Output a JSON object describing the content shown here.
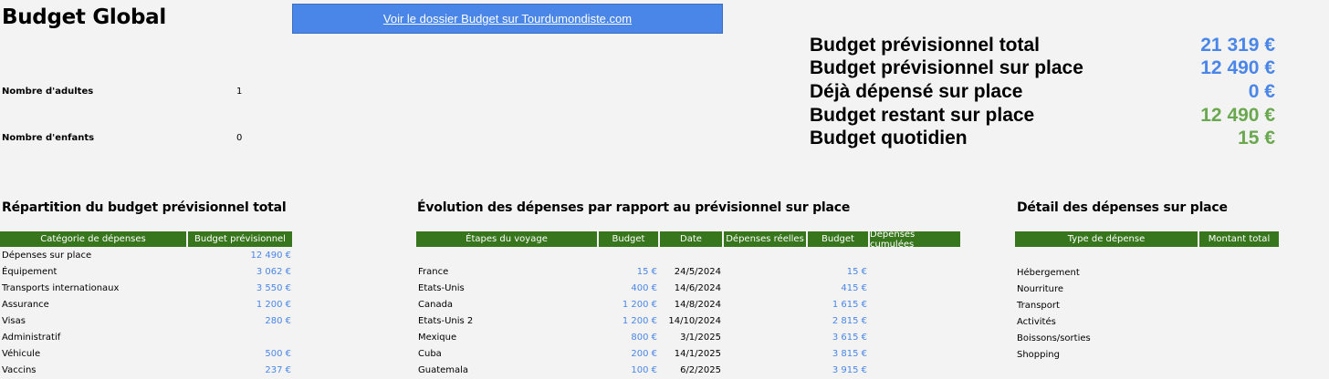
{
  "title": "Budget Global",
  "link": {
    "label": "Voir le dossier Budget sur Tourdumondiste.com"
  },
  "params": [
    {
      "label": "Nombre d'adultes",
      "value": "1"
    },
    {
      "label": "Nombre d'enfants",
      "value": "0"
    }
  ],
  "summary": [
    {
      "label": "Budget prévisionnel total",
      "value": "21 319 €",
      "color": "#4a86e8"
    },
    {
      "label": "Budget prévisionnel sur place",
      "value": "12 490 €",
      "color": "#4a86e8"
    },
    {
      "label": "Déjà dépensé sur place",
      "value": "0 €",
      "color": "#4a86e8"
    },
    {
      "label": "Budget restant sur place",
      "value": "12 490 €",
      "color": "#6aa84f"
    },
    {
      "label": "Budget quotidien",
      "value": "15 €",
      "color": "#6aa84f"
    }
  ],
  "repartition": {
    "title": "Répartition du budget prévisionnel total",
    "headers": [
      "Catégorie de dépenses",
      "Budget prévisionnel"
    ],
    "rows": [
      {
        "cat": "Dépenses sur place",
        "val": "12 490 €"
      },
      {
        "cat": "Équipement",
        "val": "3 062 €"
      },
      {
        "cat": "Transports internationaux",
        "val": "3 550 €"
      },
      {
        "cat": "Assurance",
        "val": "1 200 €"
      },
      {
        "cat": "Visas",
        "val": "280 €"
      },
      {
        "cat": "Administratif",
        "val": ""
      },
      {
        "cat": "Véhicule",
        "val": "500 €"
      },
      {
        "cat": "Vaccins",
        "val": "237 €"
      }
    ]
  },
  "evolution": {
    "title": "Évolution des dépenses par rapport au prévisionnel sur place",
    "headers": [
      "Étapes du voyage",
      "Budget",
      "Date",
      "Dépenses réelles",
      "Budget",
      "Dépenses cumulées"
    ],
    "rows": [
      {
        "etape": "France",
        "budget": "15 €",
        "date": "24/5/2024",
        "reel": "",
        "budget2": "15 €",
        "cumul": ""
      },
      {
        "etape": "Etats-Unis",
        "budget": "400 €",
        "date": "14/6/2024",
        "reel": "",
        "budget2": "415 €",
        "cumul": ""
      },
      {
        "etape": "Canada",
        "budget": "1 200 €",
        "date": "14/8/2024",
        "reel": "",
        "budget2": "1 615 €",
        "cumul": ""
      },
      {
        "etape": "Etats-Unis 2",
        "budget": "1 200 €",
        "date": "14/10/2024",
        "reel": "",
        "budget2": "2 815 €",
        "cumul": ""
      },
      {
        "etape": "Mexique",
        "budget": "800 €",
        "date": "3/1/2025",
        "reel": "",
        "budget2": "3 615 €",
        "cumul": ""
      },
      {
        "etape": "Cuba",
        "budget": "200 €",
        "date": "14/1/2025",
        "reel": "",
        "budget2": "3 815 €",
        "cumul": ""
      },
      {
        "etape": "Guatemala",
        "budget": "100 €",
        "date": "6/2/2025",
        "reel": "",
        "budget2": "3 915 €",
        "cumul": ""
      }
    ]
  },
  "detail": {
    "title": "Détail des dépenses sur place",
    "headers": [
      "Type de dépense",
      "Montant total"
    ],
    "rows": [
      {
        "type": "Hébergement",
        "val": ""
      },
      {
        "type": "Nourriture",
        "val": ""
      },
      {
        "type": "Transport",
        "val": ""
      },
      {
        "type": "Activités",
        "val": ""
      },
      {
        "type": "Boissons/sorties",
        "val": ""
      },
      {
        "type": "Shopping",
        "val": ""
      }
    ]
  }
}
